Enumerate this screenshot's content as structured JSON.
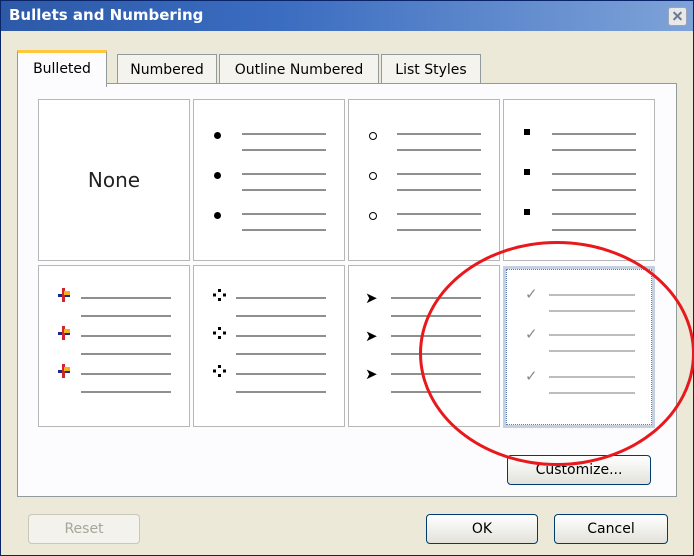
{
  "window": {
    "title": "Bullets and Numbering"
  },
  "tabs": [
    {
      "label": "Bulleted",
      "active": true
    },
    {
      "label": "Numbered",
      "active": false
    },
    {
      "label": "Outline Numbered",
      "active": false
    },
    {
      "label": "List Styles",
      "active": false
    }
  ],
  "gallery": {
    "none_label": "None",
    "styles": [
      {
        "name": "none",
        "icon": "none"
      },
      {
        "name": "filled-circle",
        "icon": "filled-circle-bullet-icon"
      },
      {
        "name": "hollow-circle",
        "icon": "hollow-circle-bullet-icon"
      },
      {
        "name": "filled-square",
        "icon": "filled-square-bullet-icon"
      },
      {
        "name": "colored-pushpin",
        "icon": "pushpin-bullet-icon"
      },
      {
        "name": "four-diamond",
        "icon": "four-diamond-bullet-icon"
      },
      {
        "name": "arrowhead",
        "icon": "arrowhead-bullet-icon",
        "glyph": "➤"
      },
      {
        "name": "checkmark",
        "icon": "checkmark-bullet-icon",
        "glyph": "✓",
        "selected": true
      }
    ]
  },
  "buttons": {
    "customize": "Customize...",
    "reset": "Reset",
    "ok": "OK",
    "cancel": "Cancel"
  },
  "colors": {
    "titlebar": "#2d5aa8",
    "annotation": "#e8181c",
    "tab_accent": "#ffc83c"
  }
}
